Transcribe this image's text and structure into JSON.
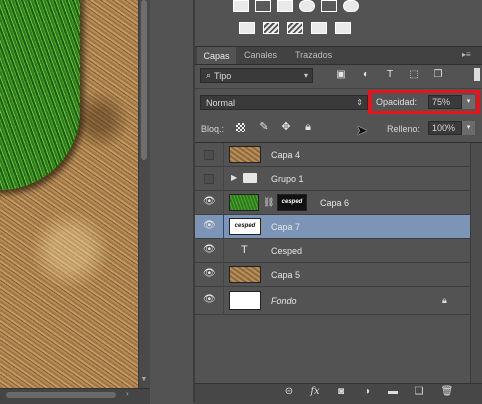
{
  "canvas": {
    "description_icon": "grass-and-sand-canvas"
  },
  "tabs": [
    {
      "label": "Capas",
      "active": true
    },
    {
      "label": "Canales",
      "active": false
    },
    {
      "label": "Trazados",
      "active": false
    }
  ],
  "filter": {
    "kind_value": "Tipo"
  },
  "blend": {
    "mode": "Normal"
  },
  "opacity": {
    "label": "Opacidad:",
    "value": "75%"
  },
  "lock": {
    "label": "Bloq.:"
  },
  "fill": {
    "label": "Relleno:",
    "value": "100%"
  },
  "layers": [
    {
      "name": "Capa 4",
      "visible": false,
      "thumb": "sand"
    },
    {
      "name": "Grupo 1",
      "visible": false,
      "thumb": "folder"
    },
    {
      "name": "Capa 6",
      "visible": true,
      "thumb": "grass",
      "mask_text": "cesped"
    },
    {
      "name": "Capa 7",
      "visible": true,
      "thumb": "text-layer",
      "thumb_text": "cesped",
      "selected": true
    },
    {
      "name": "Cesped",
      "visible": true,
      "thumb": "type"
    },
    {
      "name": "Capa 5",
      "visible": true,
      "thumb": "sand"
    },
    {
      "name": "Fondo",
      "visible": true,
      "thumb": "white",
      "locked": true
    }
  ],
  "colors": {
    "selection": "#7c94b6",
    "highlight_box": "#e8131b",
    "panel": "#535353"
  }
}
